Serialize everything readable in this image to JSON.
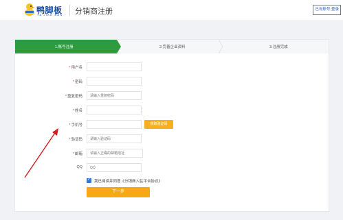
{
  "header": {
    "logo_text": "鸭脚板",
    "logo_sub": "YA JIAO BAN",
    "title": "分销商注册",
    "login_link": "已有账号,登录"
  },
  "steps": [
    {
      "label": "1.账号注册",
      "active": true
    },
    {
      "label": "2.完善企业资料",
      "active": false
    },
    {
      "label": "3.注册完成",
      "active": false
    }
  ],
  "form": {
    "username": {
      "label": "用户名",
      "required": true,
      "placeholder": ""
    },
    "password": {
      "label": "密码",
      "required": true,
      "placeholder": ""
    },
    "confirm_password": {
      "label": "重复密码",
      "required": true,
      "placeholder": "请输入重复密码"
    },
    "name": {
      "label": "姓名",
      "required": true,
      "placeholder": ""
    },
    "phone": {
      "label": "手机号",
      "required": true,
      "placeholder": ""
    },
    "sms_button": "获取验证码",
    "code": {
      "label": "验证码",
      "required": true,
      "placeholder": "请输入验证码"
    },
    "email": {
      "label": "邮箱",
      "required": true,
      "placeholder": "请输入正确的邮箱地址"
    },
    "qq": {
      "label": "QQ",
      "required": false,
      "placeholder": "QQ"
    },
    "agree_text": "我已阅读并同意《分销商入驻平台协议》",
    "agree_checked": true,
    "next_button": "下一步"
  },
  "colors": {
    "active_step": "#2e9c3e",
    "accent_button": "#f6a914",
    "link": "#2f62b8"
  }
}
